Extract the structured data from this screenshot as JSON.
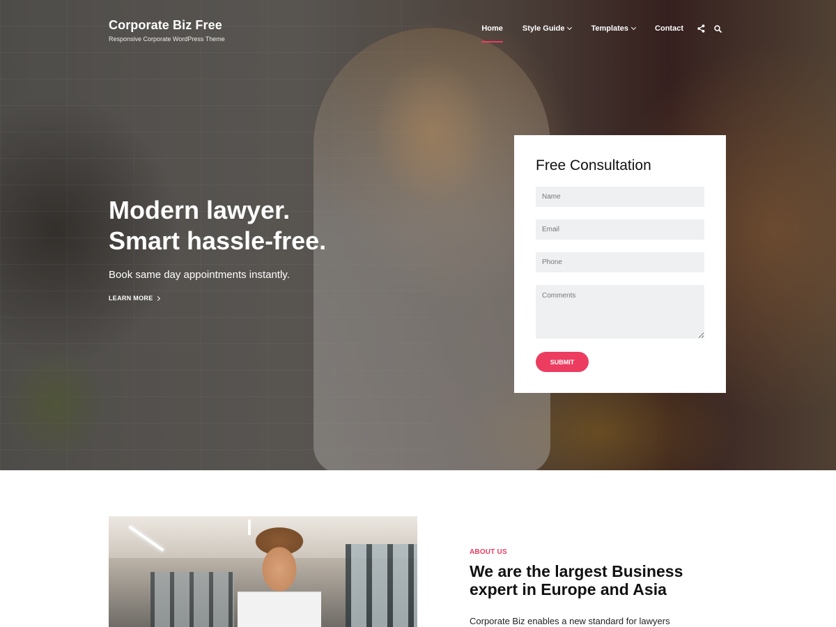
{
  "brand": {
    "title": "Corporate Biz Free",
    "tagline": "Responsive Corporate WordPress Theme"
  },
  "nav": {
    "items": [
      {
        "label": "Home",
        "active": true,
        "has_dropdown": false
      },
      {
        "label": "Style Guide",
        "active": false,
        "has_dropdown": true
      },
      {
        "label": "Templates",
        "active": false,
        "has_dropdown": true
      },
      {
        "label": "Contact",
        "active": false,
        "has_dropdown": false
      }
    ],
    "icons": [
      "share-icon",
      "search-icon"
    ]
  },
  "hero": {
    "heading_line1": "Modern lawyer.",
    "heading_line2": "Smart hassle-free.",
    "subheading": "Book same day appointments instantly.",
    "link_label": "LEARN MORE"
  },
  "consultation_form": {
    "title": "Free Consultation",
    "fields": {
      "name_placeholder": "Name",
      "email_placeholder": "Email",
      "phone_placeholder": "Phone",
      "comments_placeholder": "Comments"
    },
    "submit_label": "SUBMIT"
  },
  "about": {
    "kicker": "ABOUT US",
    "heading": "We are the largest Business expert in Europe and Asia",
    "body": "Corporate Biz enables a new standard for lawyers"
  },
  "colors": {
    "accent": "#ec3c60",
    "field_bg": "#eef0f2",
    "text_dark": "#111111",
    "white": "#ffffff"
  }
}
